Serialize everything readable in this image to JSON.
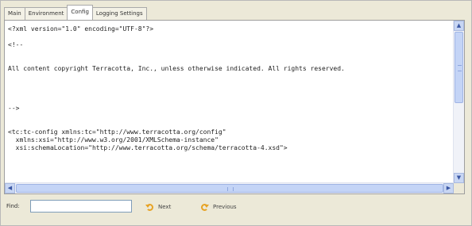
{
  "tabs": [
    {
      "label": "Main"
    },
    {
      "label": "Environment"
    },
    {
      "label": "Config",
      "active": true
    },
    {
      "label": "Logging Settings"
    }
  ],
  "editor": {
    "lines": [
      "<?xml version=\"1.0\" encoding=\"UTF-8\"?>",
      "",
      "<!--",
      "",
      "",
      "All content copyright Terracotta, Inc., unless otherwise indicated. All rights reserved.",
      "",
      "",
      "",
      "",
      "-->",
      "",
      "",
      "<tc:tc-config xmlns:tc=\"http://www.terracotta.org/config\"",
      "  xmlns:xsi=\"http://www.w3.org/2001/XMLSchema-instance\"",
      "  xsi:schemaLocation=\"http://www.terracotta.org/schema/terracotta-4.xsd\">"
    ]
  },
  "findbar": {
    "label": "Find:",
    "value": "",
    "next_label": "Next",
    "previous_label": "Previous"
  },
  "icons": {
    "next": "find-next-arrow-icon",
    "previous": "find-previous-arrow-icon"
  },
  "colors": {
    "scrollbar": "#c4d4f6",
    "find_arrow": "#e7a325"
  }
}
